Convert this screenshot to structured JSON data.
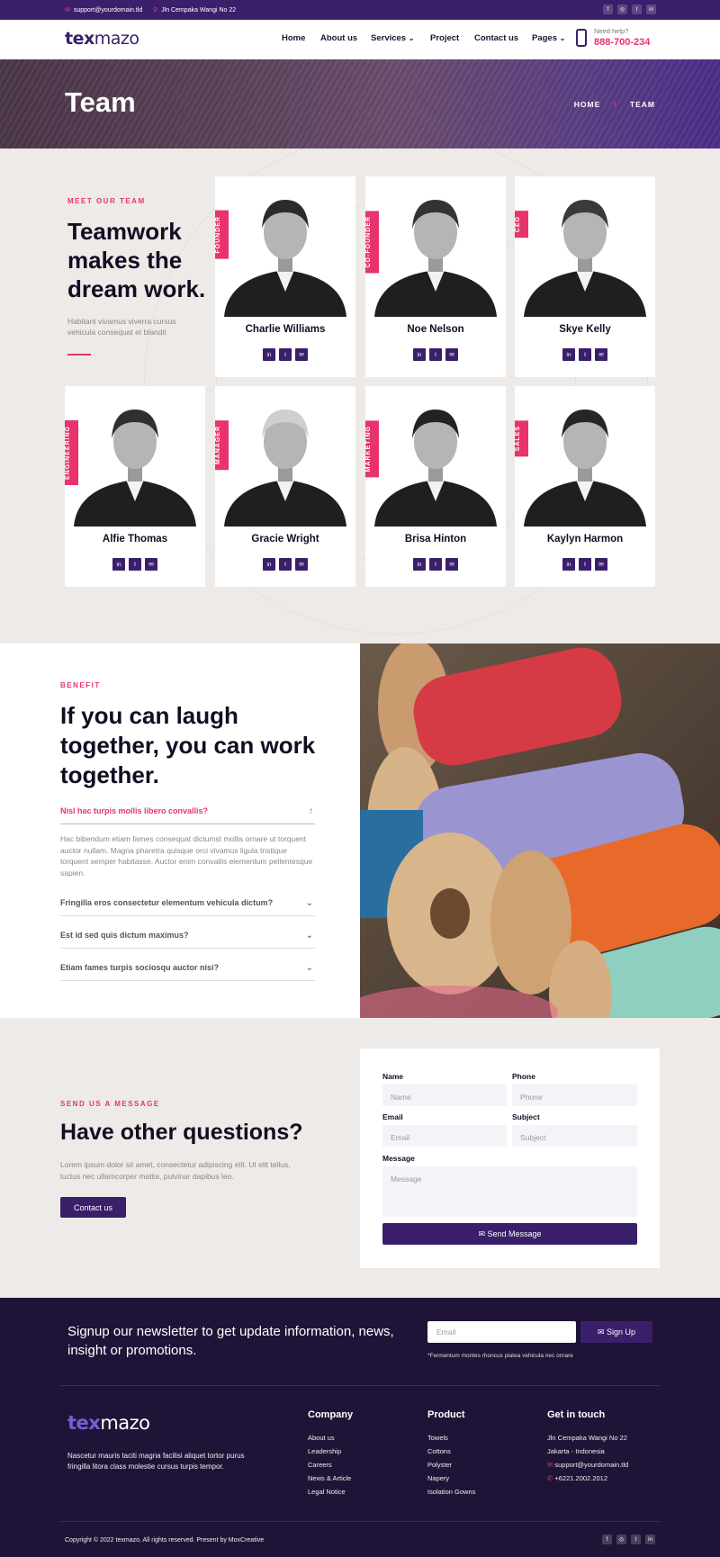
{
  "topbar": {
    "email": "support@yourdomain.tld",
    "address": "Jln Cempaka Wangi No 22",
    "socials": [
      "f",
      "◎",
      "t",
      "in"
    ]
  },
  "nav": {
    "logo_a": "tex",
    "logo_b": "mazo",
    "items": [
      "Home",
      "About us",
      "Services",
      "Project",
      "Contact us",
      "Pages"
    ],
    "help_label": "Need help?",
    "help_phone": "888-700-234"
  },
  "hero": {
    "title": "Team",
    "breadcrumb_home": "HOME",
    "breadcrumb_current": "TEAM"
  },
  "team": {
    "kicker": "MEET OUR TEAM",
    "title": "Teamwork makes the dream work.",
    "description": "Habitant vivamus viverra cursus vehicula consequat et blandit",
    "members": [
      {
        "name": "Charlie Williams",
        "role": "FOUNDER"
      },
      {
        "name": "Noe Nelson",
        "role": "CO-FOUNDER"
      },
      {
        "name": "Skye Kelly",
        "role": "CEO"
      },
      {
        "name": "Alfie Thomas",
        "role": "ENGINEERING"
      },
      {
        "name": "Gracie Wright",
        "role": "MANAGER"
      },
      {
        "name": "Brisa Hinton",
        "role": "MARKETING"
      },
      {
        "name": "Kaylyn Harmon",
        "role": "SALES"
      }
    ],
    "social_icons": [
      "in",
      "t",
      "✉"
    ]
  },
  "benefit": {
    "kicker": "BENEFIT",
    "title": "If you can laugh together, you can work together.",
    "faq": [
      {
        "q": "Nisl hac turpis mollis libero convallis?",
        "a": "Hac bibendum etiam fames consequat dictumst mollis ornare ut torquent auctor nullam. Magna pharetra quisque orci vivamus ligula tristique torquent semper habitasse. Auctor enim convallis elementum pellentesque sapien."
      },
      {
        "q": "Fringilla eros consectetur elementum vehicula dictum?"
      },
      {
        "q": "Est id sed quis dictum maximus?"
      },
      {
        "q": "Etiam fames turpis sociosqu auctor nisi?"
      }
    ]
  },
  "contact": {
    "kicker": "SEND US A MESSAGE",
    "title": "Have other questions?",
    "description": "Lorem ipsum dolor sit amet, consectetur adipiscing elit. Ut elit tellus, luctus nec ullamcorper mattis, pulvinar dapibus leo.",
    "button": "Contact us",
    "form": {
      "name_label": "Name",
      "name_placeholder": "Name",
      "phone_label": "Phone",
      "phone_placeholder": "Phone",
      "email_label": "Email",
      "email_placeholder": "Email",
      "subject_label": "Subject",
      "subject_placeholder": "Subject",
      "message_label": "Message",
      "message_placeholder": "Message",
      "submit": "✉ Send Message"
    }
  },
  "footer": {
    "newsletter_text": "Signup our newsletter to get update information, news, insight or promotions.",
    "email_placeholder": "Email",
    "signup_button": "✉ Sign Up",
    "note": "*Fermentum montes rhoncus platea vehicula nec ornare",
    "logo_a": "tex",
    "logo_b": "mazo",
    "description": "Nascetur mauris taciti magna facilisi aliquet tortor purus fringilla litora class molestie cursus turpis tempor.",
    "company_title": "Company",
    "company_items": [
      "About us",
      "Leadership",
      "Careers",
      "News & Article",
      "Legal Notice"
    ],
    "product_title": "Product",
    "product_items": [
      "Towels",
      "Cottons",
      "Polyster",
      "Napery",
      "Isolation Gowns"
    ],
    "touch_title": "Get in touch",
    "touch_address1": "Jln Cempaka Wangi No 22",
    "touch_address2": "Jakarta - Indonesia",
    "touch_email": "support@yourdomain.tld",
    "touch_phone": "+6221.2002.2012",
    "copyright": "Copyright © 2022 texmazo, All rights reserved. Present by MoxCreative",
    "socials": [
      "f",
      "◎",
      "t",
      "in"
    ]
  },
  "colors": {
    "primary": "#3a1f6b",
    "accent": "#e8336d",
    "footer_bg": "#1f1437",
    "section_bg": "#edeae7"
  }
}
